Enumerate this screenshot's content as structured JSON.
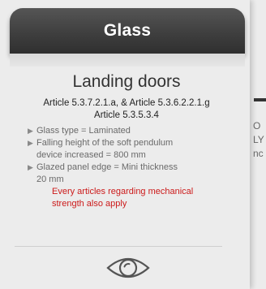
{
  "header": {
    "title": "Glass"
  },
  "main": {
    "section_title": "Landing doors",
    "articles_line1": "Article 5.3.7.2.1.a, & Article 5.3.6.2.2.1.g",
    "articles_line2": "Article 5.3.5.3.4",
    "bullets": [
      {
        "line1": "Glass type = Laminated"
      },
      {
        "line1": "Falling height of the soft pendulum",
        "line2": "device increased = 800 mm"
      },
      {
        "line1": "Glazed panel edge = Mini thickness",
        "line2": "20 mm"
      }
    ],
    "note_line1": "Every articles regarding mechanical",
    "note_line2": "strength also apply",
    "view_icon": "eye-icon"
  },
  "right_panel": {
    "line1": "O",
    "line2": "LY",
    "line3": "nc"
  },
  "colors": {
    "header_bg": "#3f3f3f",
    "note_red": "#cc1a1a",
    "text_gray": "#6a6a6a"
  }
}
